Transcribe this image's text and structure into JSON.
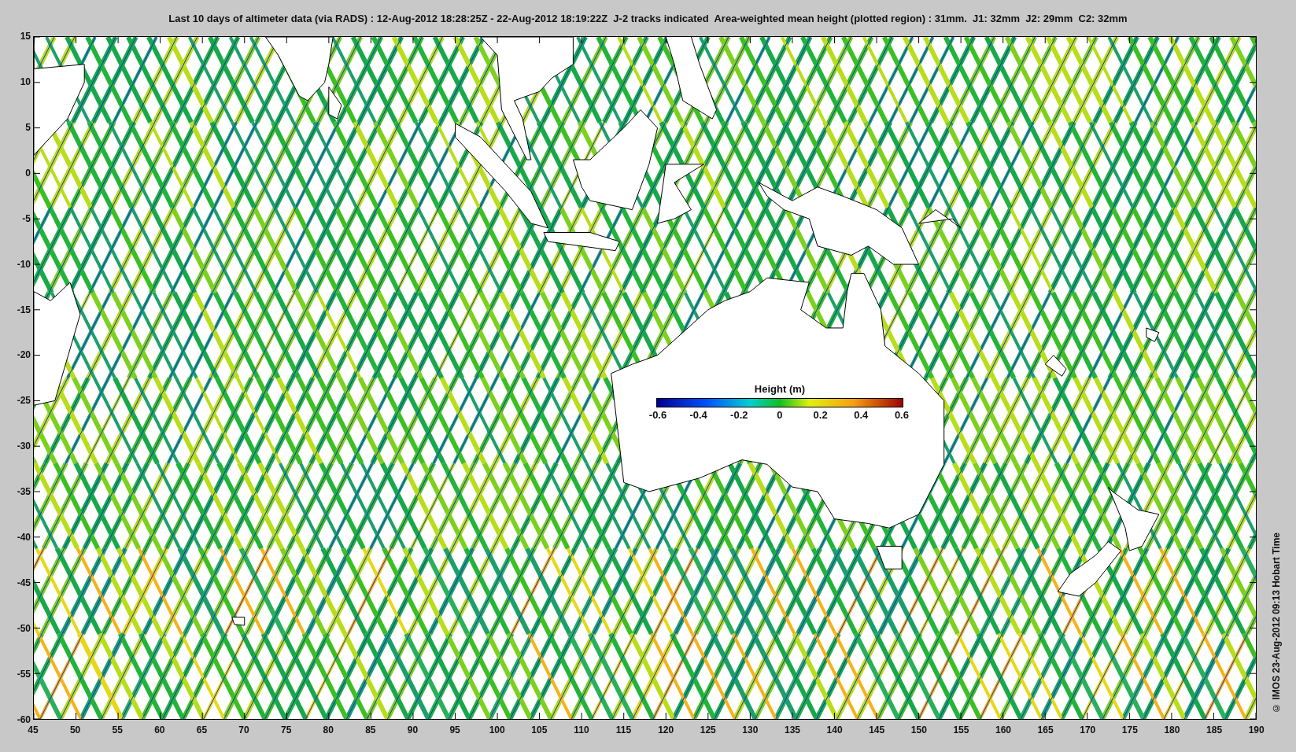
{
  "title": "Last 10 days of altimeter data (via RADS) : 12-Aug-2012 18:28:25Z - 22-Aug-2012 18:19:22Z  J-2 tracks indicated  Area-weighted mean height (plotted region) : 31mm.  J1: 32mm  J2: 29mm  C2: 32mm",
  "y_ticks": [
    "15",
    "10",
    "5",
    "0",
    "-5",
    "-10",
    "-15",
    "-20",
    "-25",
    "-30",
    "-35",
    "-40",
    "-45",
    "-50",
    "-55",
    "-60"
  ],
  "x_ticks": [
    "45",
    "50",
    "55",
    "60",
    "65",
    "70",
    "75",
    "80",
    "85",
    "90",
    "95",
    "100",
    "105",
    "110",
    "115",
    "120",
    "125",
    "130",
    "135",
    "140",
    "145",
    "150",
    "155",
    "160",
    "165",
    "170",
    "175",
    "180",
    "185",
    "190"
  ],
  "colorbar": {
    "title": "Height (m)",
    "ticks": [
      "-0.6",
      "-0.4",
      "-0.2",
      "0",
      "0.2",
      "0.4",
      "0.6"
    ]
  },
  "credit": "© IMOS 23-Aug-2012 09:13 Hobart Time"
}
